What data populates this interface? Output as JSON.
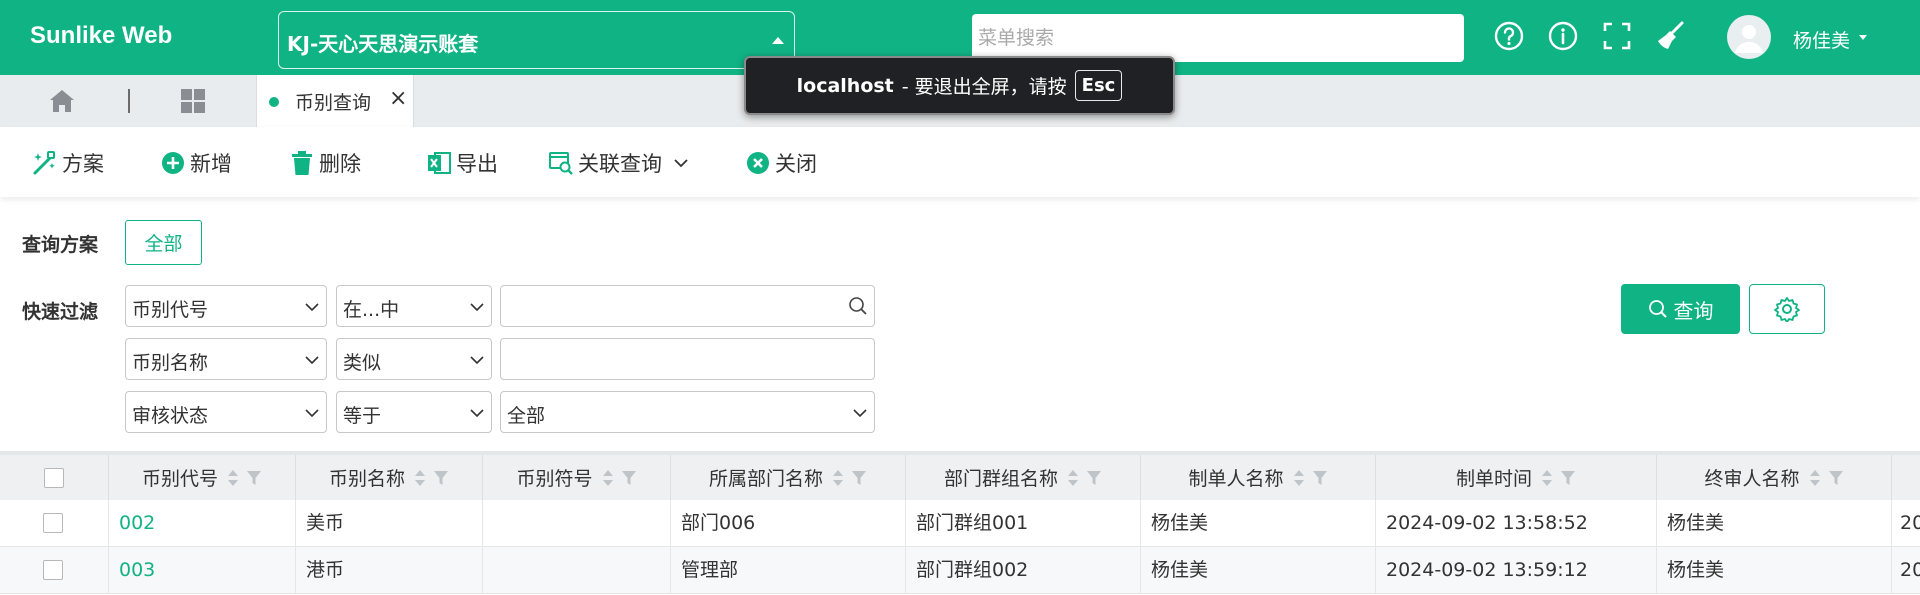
{
  "header": {
    "brand": "Sunlike Web",
    "account_label": "KJ-天心天思演示账套",
    "search_placeholder": "菜单搜索",
    "username": "杨佳美",
    "icons": [
      "help-circle-icon",
      "info-circle-icon",
      "fullscreen-icon",
      "broom-icon",
      "chevron-down-icon"
    ]
  },
  "tabs": {
    "active_label": "币别查询"
  },
  "toolbar": {
    "scheme": "方案",
    "add": "新增",
    "delete": "删除",
    "export": "导出",
    "related": "关联查询",
    "close": "关闭"
  },
  "filters": {
    "scheme_label": "查询方案",
    "scheme_all": "全部",
    "quick_label": "快速过滤",
    "rows": [
      {
        "field": "币别代号",
        "op": "在...中",
        "value": ""
      },
      {
        "field": "币别名称",
        "op": "类似",
        "value": ""
      },
      {
        "field": "审核状态",
        "op": "等于",
        "value": "全部"
      }
    ],
    "query_button": "查询"
  },
  "grid": {
    "columns": [
      "币别代号",
      "币别名称",
      "币别符号",
      "所属部门名称",
      "部门群组名称",
      "制单人名称",
      "制单时间",
      "终审人名称"
    ],
    "rows": [
      [
        "002",
        "美币",
        "",
        "部门006",
        "部门群组001",
        "杨佳美",
        "2024-09-02 13:58:52",
        "杨佳美",
        "20"
      ],
      [
        "003",
        "港币",
        "",
        "管理部",
        "部门群组002",
        "杨佳美",
        "2024-09-02 13:59:12",
        "杨佳美",
        "20"
      ]
    ]
  },
  "fullscreen_notice": {
    "host": "localhost",
    "message": "- 要退出全屏，请按",
    "key": "Esc"
  },
  "colors": {
    "brand": "#10b384",
    "tabbar": "#e9ecee",
    "toast_bg": "#202124"
  }
}
